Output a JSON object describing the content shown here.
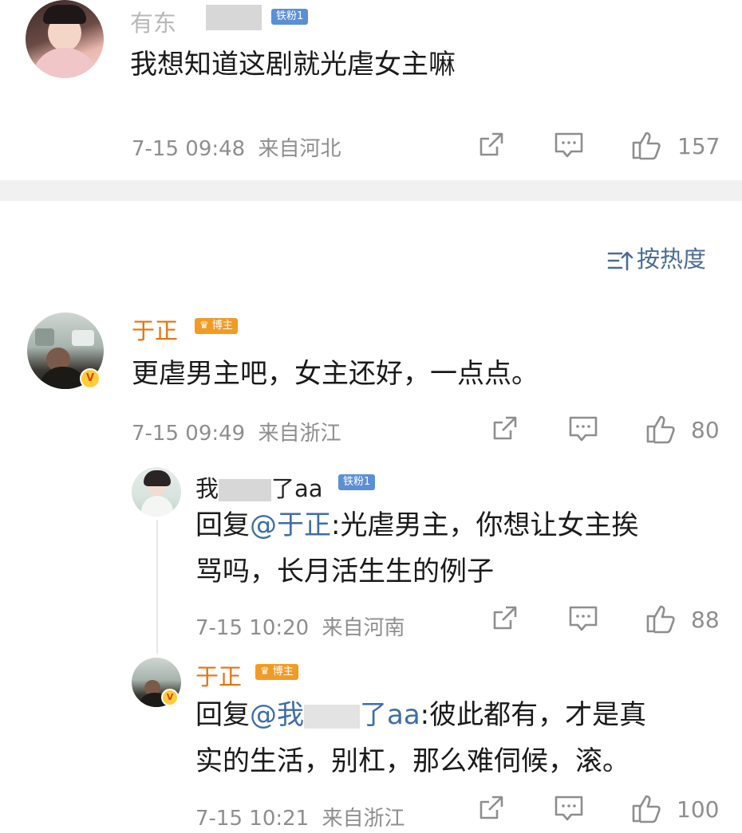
{
  "colors": {
    "accent_orange": "#e8730c",
    "mention_blue": "#3e6ea8",
    "meta_gray": "#8e8e8e",
    "fan_badge": "#5b8fd6",
    "blogger_badge": "#f29b24"
  },
  "top_comment": {
    "username": "有东",
    "badge": "铁粉1",
    "text": "我想知道这剧就光虐女主嘛",
    "time": "7-15 09:48",
    "location": "来自河北",
    "likes": "157"
  },
  "sort": {
    "label": "按热度",
    "icon": "sort-icon"
  },
  "comment_main": {
    "username": "于正",
    "badge": "博主",
    "text": "更虐男主吧，女主还好，一点点。",
    "time": "7-15 09:49",
    "location": "来自浙江",
    "likes": "80"
  },
  "reply_1": {
    "username_a": "我",
    "username_b": "了aa",
    "badge": "铁粉1",
    "prefix": "回复",
    "mention": "@于正",
    "line1": ":光虐男主，你想让女主挨",
    "line2": "骂吗，长月活生生的例子",
    "time": "7-15 10:20",
    "location": "来自河南",
    "likes": "88"
  },
  "reply_2": {
    "username": "于正",
    "badge": "博主",
    "prefix": "回复",
    "mention_a": "@我",
    "mention_b": "了aa",
    "line1": ":彼此都有，才是真",
    "line2": "实的生活，别杠，那么难伺候，滚。",
    "time": "7-15 10:21",
    "location": "来自浙江",
    "likes": "100"
  }
}
